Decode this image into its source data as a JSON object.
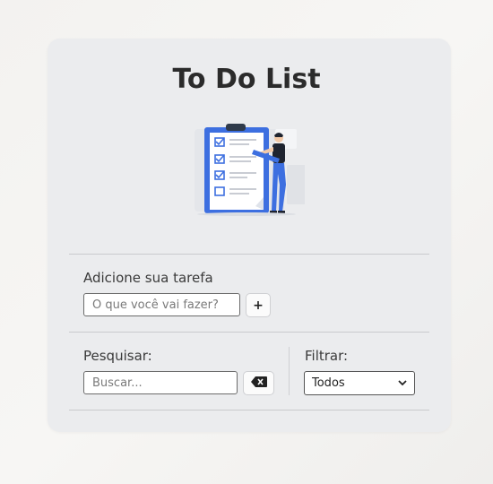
{
  "app": {
    "title": "To Do List"
  },
  "add_section": {
    "label": "Adicione sua tarefa",
    "input_placeholder": "O que você vai fazer?",
    "add_button_label": "+"
  },
  "search_section": {
    "label": "Pesquisar:",
    "input_placeholder": "Buscar...",
    "clear_icon": "backspace-icon"
  },
  "filter_section": {
    "label": "Filtrar:",
    "selected": "Todos"
  },
  "illustration": {
    "icon": "checklist-clipboard-person-illustration"
  },
  "colors": {
    "card_background": "#ebecee",
    "accent_blue": "#3d6fe0",
    "text_dark": "#2b2b2b"
  }
}
